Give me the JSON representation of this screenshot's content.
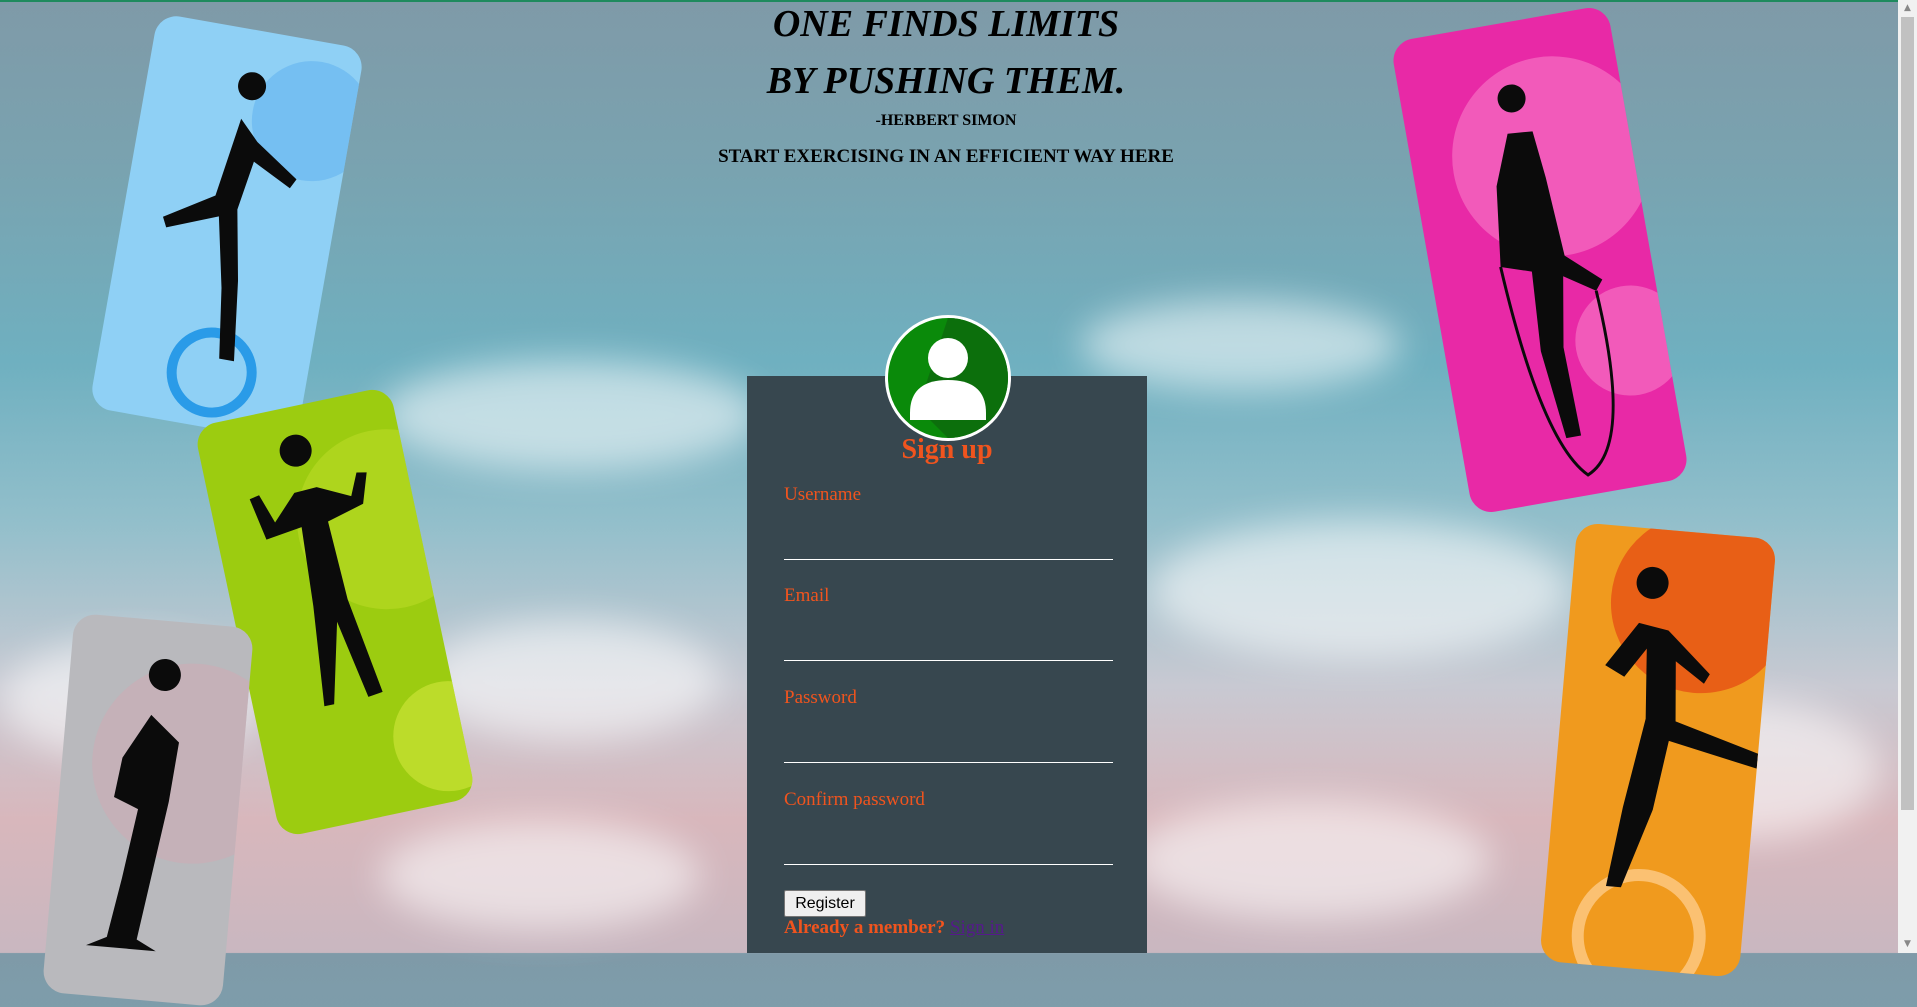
{
  "header": {
    "quote_line1": "ONE FINDS LIMITS",
    "quote_line2": "BY PUSHING THEM.",
    "author": "-HERBERT SIMON",
    "tagline": "START EXERCISING IN AN EFFICIENT WAY HERE"
  },
  "form": {
    "title": "Sign up",
    "username_label": "Username",
    "username_value": "",
    "email_label": "Email",
    "email_value": "",
    "password_label": "Password",
    "password_value": "",
    "confirm_label": "Confirm password",
    "confirm_value": "",
    "register_label": "Register",
    "member_text": "Already a member?",
    "signin_label": "Sign in"
  },
  "icons": {
    "avatar": "user-avatar-icon"
  },
  "colors": {
    "panel": "#37474f",
    "accent": "#f0541e",
    "avatar": "#0a8a0a",
    "card_blue": "#8fd0f5",
    "card_green": "#9ccc10",
    "card_gray": "#b9b9bd",
    "card_pink": "#e829a6",
    "card_orange": "#f09a1e"
  }
}
